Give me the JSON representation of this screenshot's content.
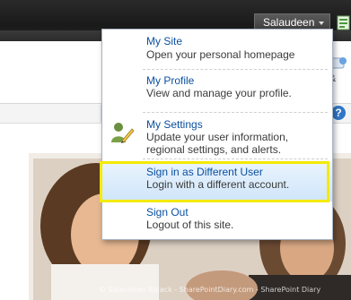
{
  "topbar": {
    "user_name": "Salaudeen"
  },
  "menu": {
    "items": [
      {
        "title": "My Site",
        "description": [
          "Open your personal homepage"
        ]
      },
      {
        "title": "My Profile",
        "description": [
          "View and manage your profile."
        ]
      },
      {
        "title": "My Settings",
        "description": [
          "Update your user information,",
          "regional settings, and alerts."
        ]
      },
      {
        "title": "Sign in as Different User",
        "description": [
          "Login with a different account."
        ]
      },
      {
        "title": "Sign Out",
        "description": [
          "Logout of this site."
        ]
      }
    ],
    "highlight_color": "#f4ea00",
    "link_color": "#0a4f9f"
  },
  "page": {
    "help_glyph": "?",
    "ribbon_label": "&",
    "watermark": "© Salaudeen Rajack - SharePointDiary.com - SharePoint Diary"
  }
}
